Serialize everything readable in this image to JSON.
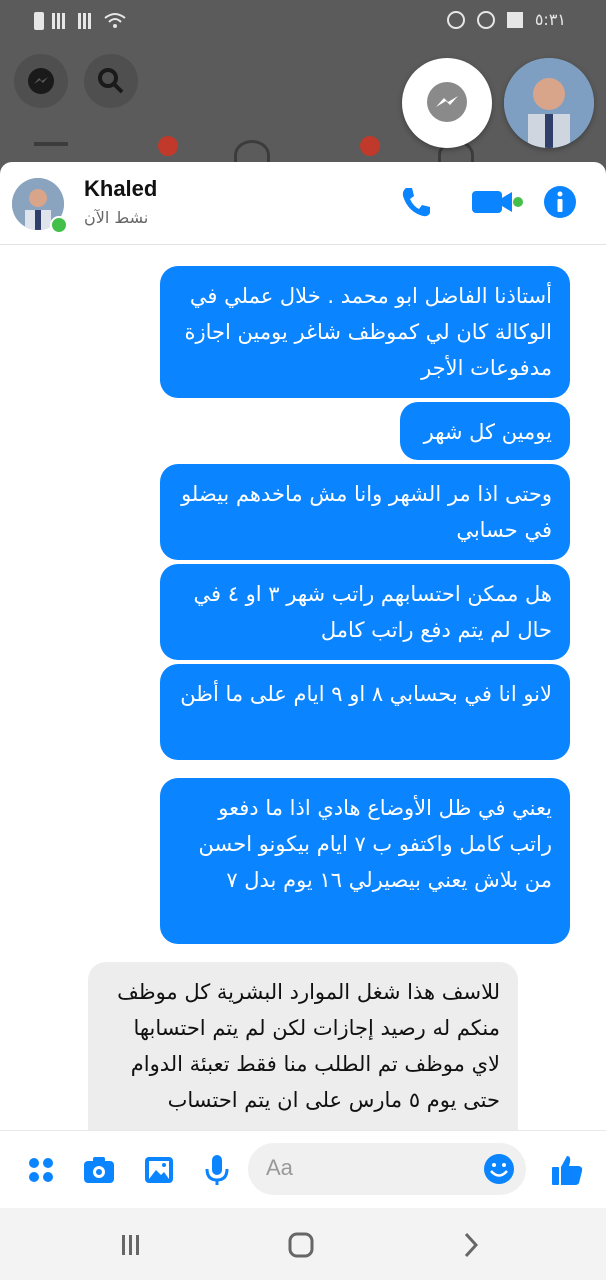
{
  "status_bar": {
    "time": "٥:٣١"
  },
  "chat": {
    "contact_name": "Khaled",
    "status": "نشط الآن"
  },
  "messages": [
    {
      "type": "sent",
      "text": "أستاذنا الفاضل ابو محمد . خلال عملي في الوكالة كان لي كموظف شاغر يومين اجازة مدفوعات الأجر"
    },
    {
      "type": "sent",
      "text": "يومين كل شهر"
    },
    {
      "type": "sent",
      "text": "وحتى اذا مر الشهر وانا مش ماخدهم بيضلو في حسابي"
    },
    {
      "type": "sent",
      "text": "هل ممكن احتسابهم راتب شهر ٣ او ٤ في حال لم يتم دفع راتب كامل"
    },
    {
      "type": "sent",
      "text": "لانو انا في بحسابي ٨ او ٩ ايام على ما أظن"
    },
    {
      "type": "sent",
      "text": "يعني في ظل الأوضاع هادي اذا ما دفعو راتب كامل واكتفو ب ٧ ايام بيكونو احسن من بلاش يعني بيصيرلي ١٦ يوم بدل ٧"
    },
    {
      "type": "received",
      "text": "للاسف هذا شغل الموارد البشرية كل موظف منكم له رصيد إجازات لكن لم يتم احتسابها لاي موظف تم الطلب منا فقط تعبئة الدوام حتى يوم ٥ مارس على ان يتم احتساب"
    }
  ],
  "composer": {
    "placeholder": "Aa"
  },
  "colors": {
    "accent": "#0a84ff",
    "online": "#44c04a",
    "received_bg": "#ededed"
  },
  "icons": [
    "messenger-icon",
    "search-icon",
    "phone-icon",
    "video-icon",
    "info-icon",
    "apps-icon",
    "camera-icon",
    "gallery-icon",
    "microphone-icon",
    "emoji-icon",
    "like-icon",
    "recent-apps-icon",
    "home-icon",
    "back-icon"
  ]
}
